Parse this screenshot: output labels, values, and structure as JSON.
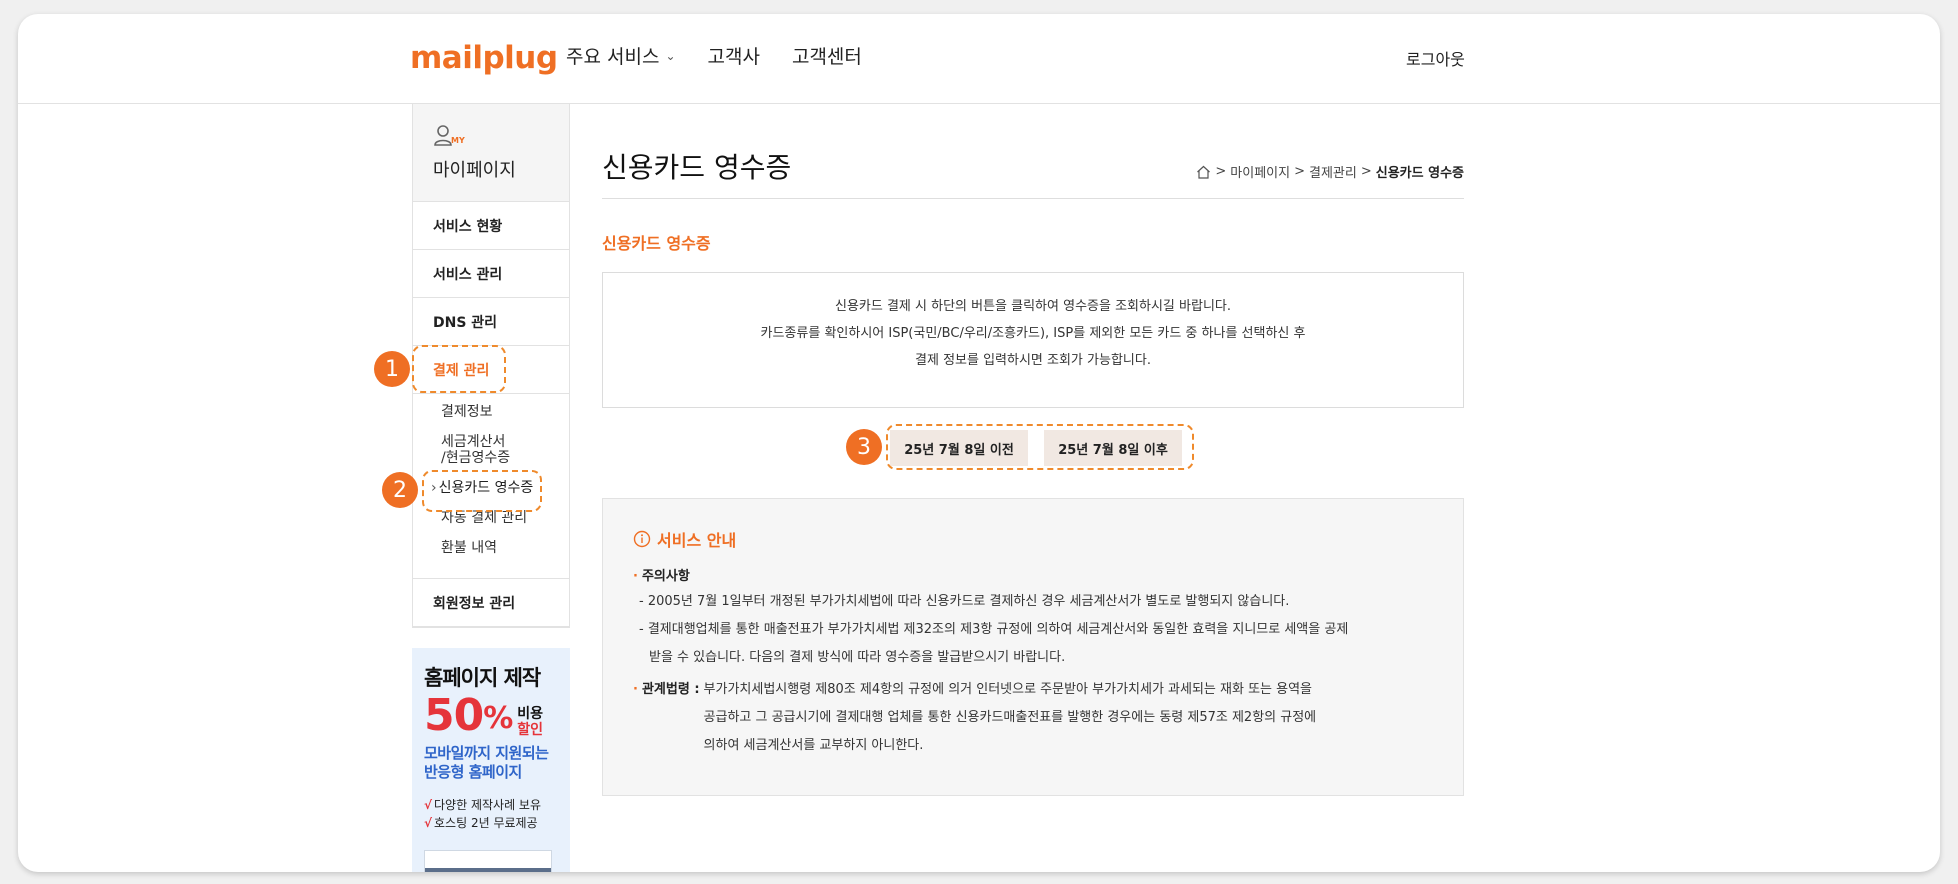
{
  "header": {
    "logo": "mailplug",
    "nav": [
      "주요 서비스",
      "고객사",
      "고객센터"
    ],
    "logout": "로그아웃"
  },
  "sidebar": {
    "my_tag": "MY",
    "title": "마이페이지",
    "menu": {
      "service_status": "서비스 현황",
      "service_manage": "서비스 관리",
      "dns_manage": "DNS 관리",
      "payment_manage": "결제 관리",
      "member_manage": "회원정보 관리"
    },
    "submenu": {
      "payment_info": "결제정보",
      "tax_invoice_l1": "세금계산서",
      "tax_invoice_l2": "/현금영수증",
      "card_receipt": "신용카드 영수증",
      "auto_payment": "자동 결제 관리",
      "refund": "환불 내역"
    }
  },
  "banner": {
    "title": "홈페이지 제작",
    "percent": "50",
    "percent_sign": "%",
    "cost": "비용",
    "discount": "할인",
    "sub1": "모바일까지 지원되는",
    "sub2": "반응형 홈페이지",
    "check1": "다양한 제작사례 보유",
    "check2": "호스팅 2년 무료제공"
  },
  "main": {
    "title": "신용카드 영수증",
    "breadcrumb": [
      "마이페이지",
      "결제관리",
      "신용카드 영수증"
    ],
    "section_title": "신용카드 영수증",
    "notice": [
      "신용카드 결제 시 하단의 버튼을 클릭하여 영수증을 조회하시길 바랍니다.",
      "카드종류를 확인하시어 ISP(국민/BC/우리/조흥카드), ISP를 제외한 모든 카드 중 하나를 선택하신 후",
      "결제 정보를 입력하시면 조회가 가능합니다."
    ],
    "btn_before": "25년 7월 8일 이전",
    "btn_after": "25년 7월 8일 이후",
    "info": {
      "heading": "서비스 안내",
      "caution_label": "주의사항",
      "caution1": "- 2005년 7월 1일부터 개정된 부가가치세법에 따라 신용카드로 결제하신 경우 세금계산서가 별도로 발행되지 않습니다.",
      "caution2": "- 결제대행업체를 통한 매출전표가 부가가치세법 제32조의 제3항 규정에 의하여 세금계산서와 동일한 효력을 지니므로 세액을 공제",
      "caution3": "받을 수 있습니다. 다음의 결제 방식에 따라 영수증을 발급받으시기 바랍니다.",
      "law_label": "관계법령 :",
      "law1": "부가가치세법시행령 제80조 제4항의 규정에 의거 인터넷으로 주문받아 부가가치세가 과세되는 재화 또는 용역을",
      "law2": "공급하고 그 공급시기에 결제대행 업체를 통한 신용카드매출전표를 발행한 경우에는 동령 제57조 제2항의 규정에",
      "law3": "의하여 세금계산서를 교부하지 아니한다."
    }
  },
  "callouts": [
    "1",
    "2",
    "3"
  ],
  "colors": {
    "accent": "#ef6f24",
    "banner_red": "#e5343a",
    "banner_blue": "#2f65c9",
    "button_bg": "#f1e8e2"
  }
}
